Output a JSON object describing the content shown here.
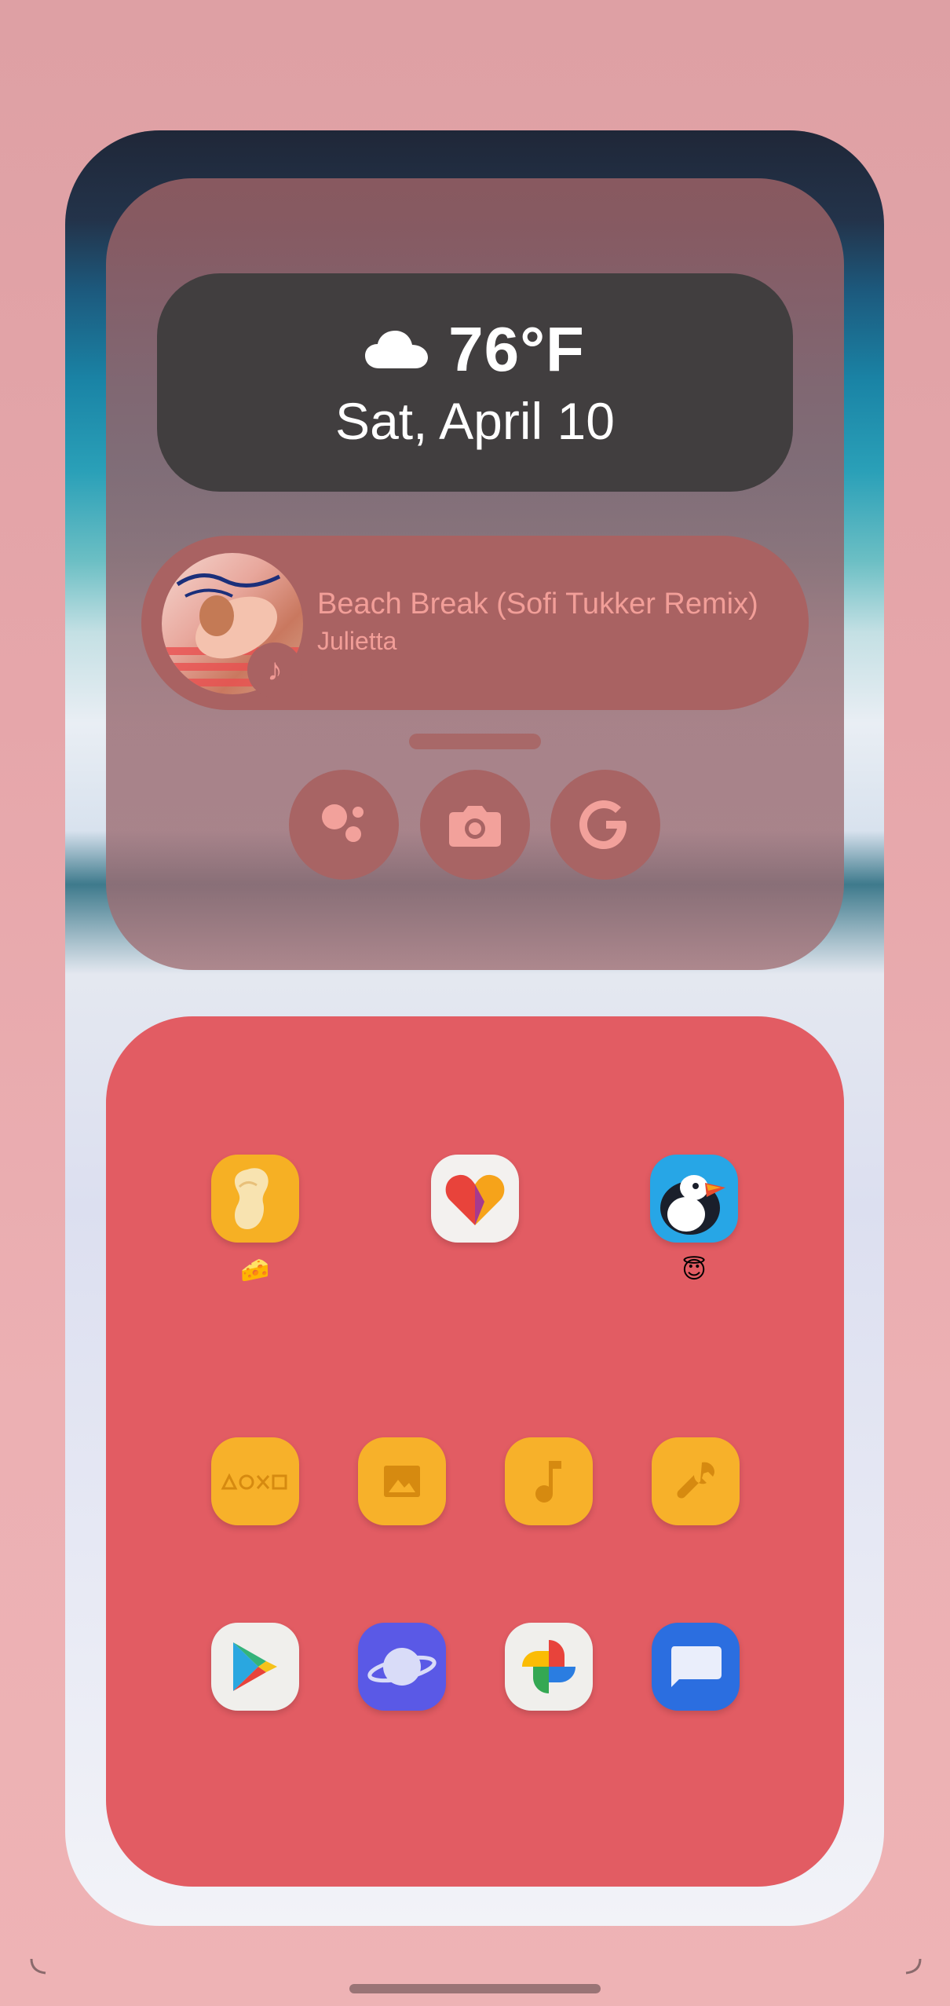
{
  "weather": {
    "icon": "cloud-icon",
    "temperature": "76°F",
    "date": "Sat, April 10"
  },
  "now_playing": {
    "title": "Beach Break (Sofi Tukker Remix)",
    "artist": "Julietta",
    "badge_icon": "music-note-icon"
  },
  "shortcuts": [
    {
      "icon": "google-assistant-icon"
    },
    {
      "icon": "camera-icon"
    },
    {
      "icon": "google-search-icon"
    }
  ],
  "apps": {
    "row1": [
      {
        "icon": "peanut-app-icon",
        "label": "🧀"
      },
      {
        "icon": "heart-app-icon",
        "label": ""
      },
      {
        "icon": "puffin-browser-icon",
        "label": "😇"
      }
    ],
    "row2": [
      {
        "icon": "games-folder-icon"
      },
      {
        "icon": "photos-folder-icon"
      },
      {
        "icon": "music-folder-icon"
      },
      {
        "icon": "tools-folder-icon"
      }
    ],
    "row3": [
      {
        "icon": "play-store-icon"
      },
      {
        "icon": "samsung-internet-icon"
      },
      {
        "icon": "google-photos-icon"
      },
      {
        "icon": "messages-icon"
      }
    ]
  },
  "colors": {
    "app_panel": "#e25c63",
    "accent_text": "#f29e98",
    "folder": "#f7b12a"
  }
}
